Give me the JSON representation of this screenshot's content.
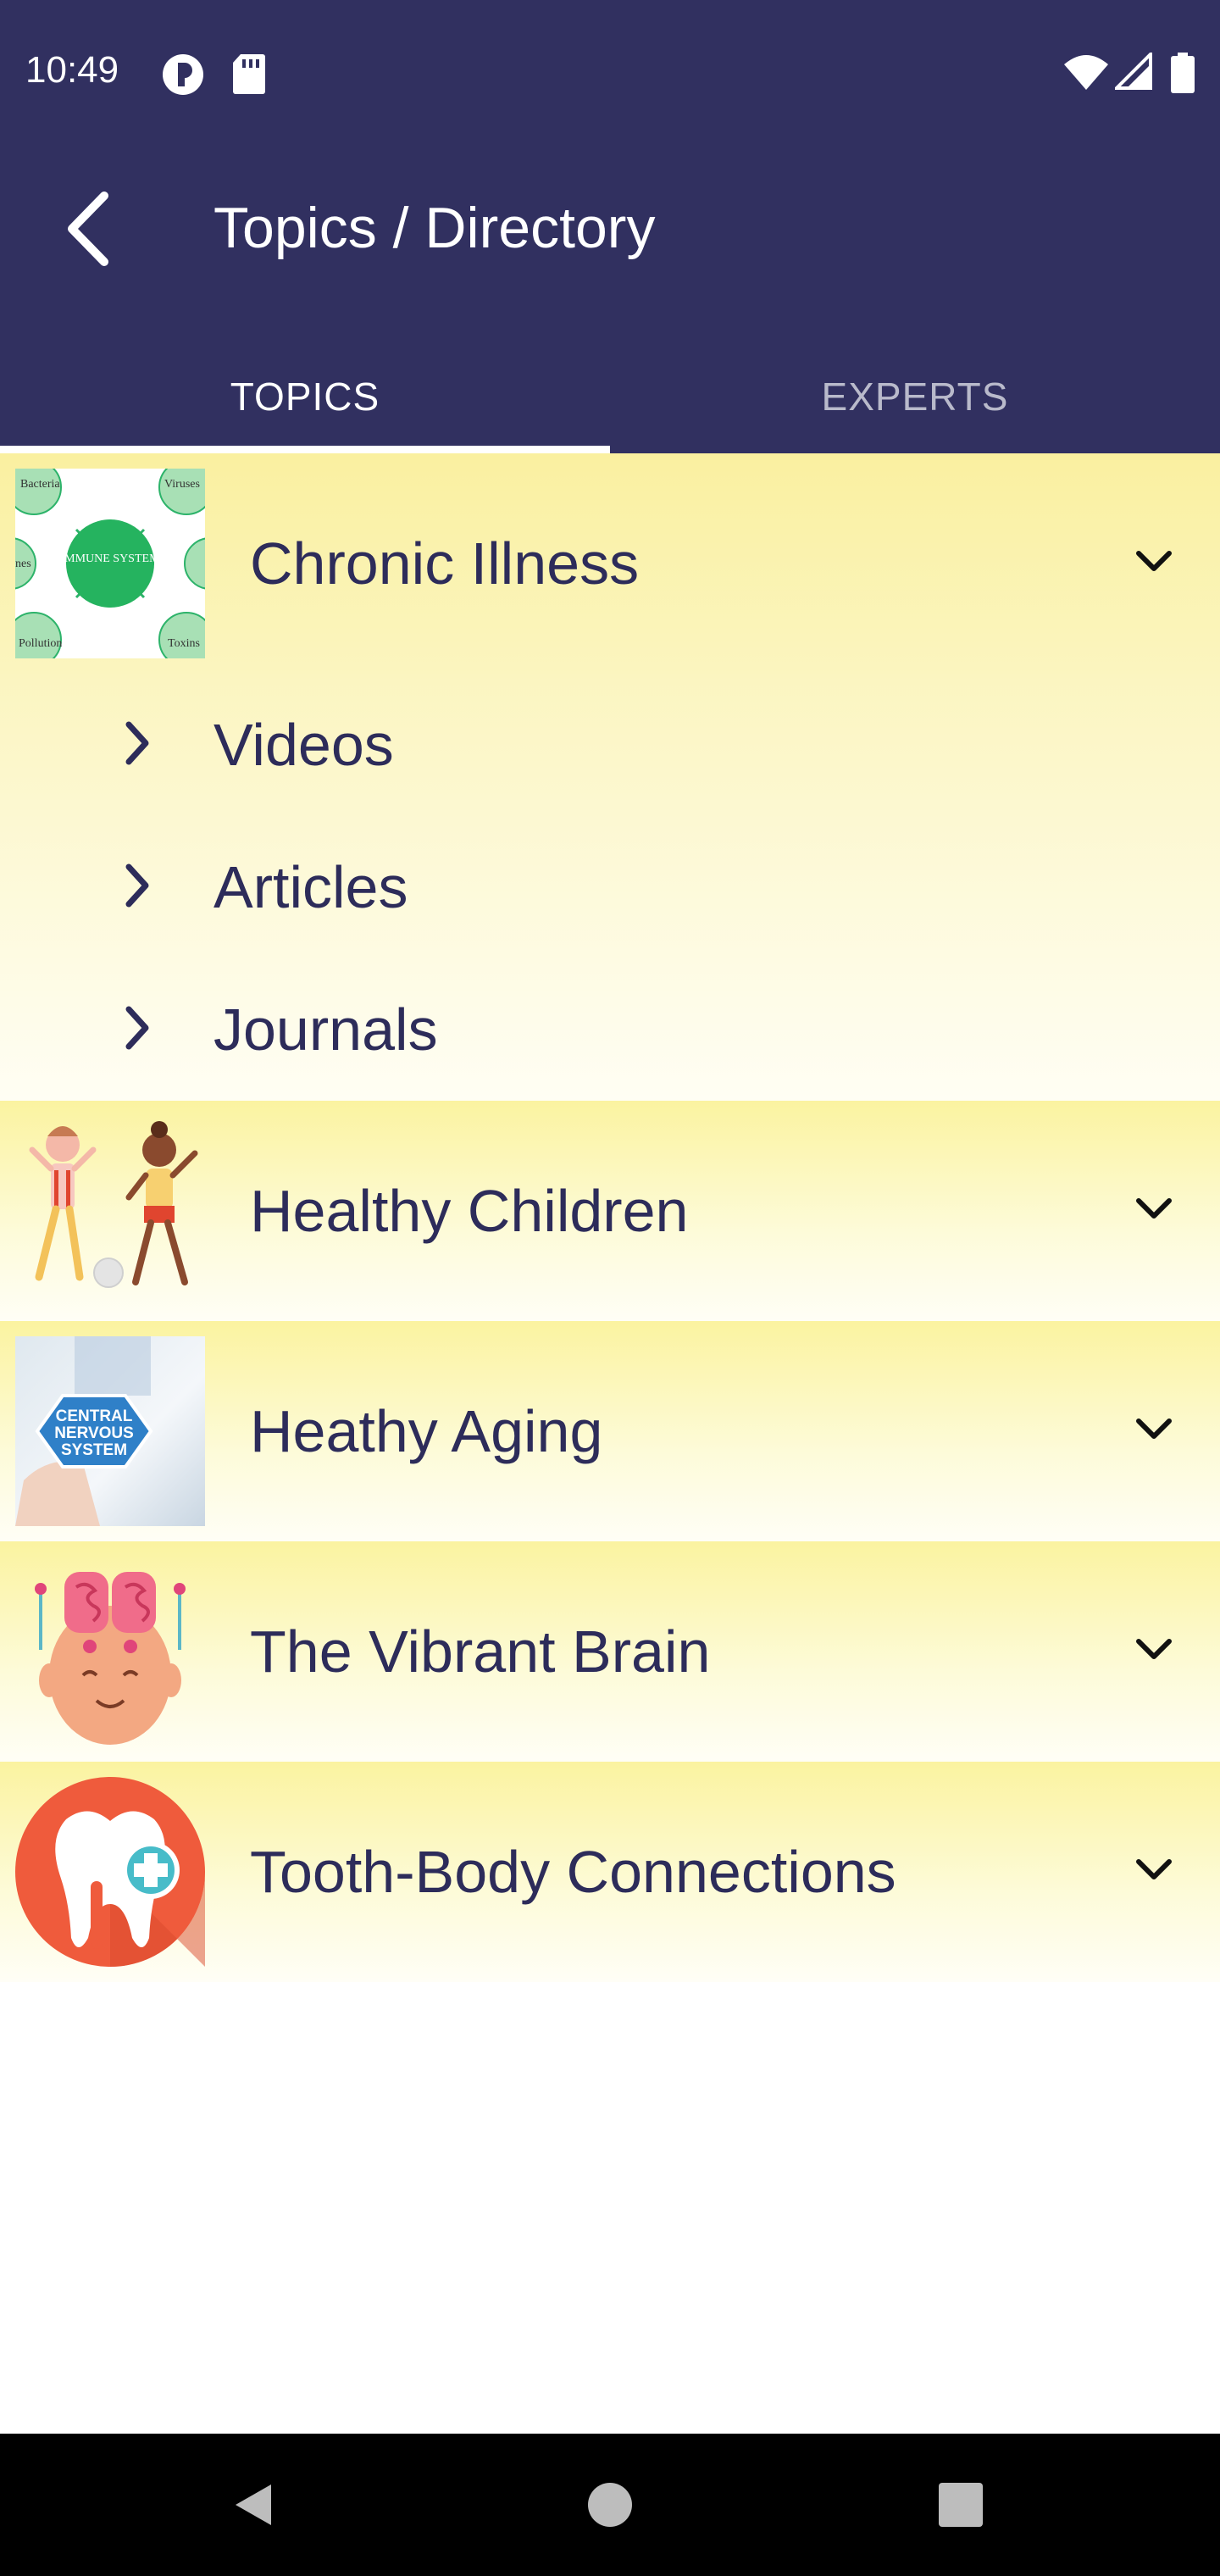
{
  "status_bar": {
    "time": "10:49",
    "icons": [
      "media-icon",
      "sd-card-icon",
      "wifi-icon",
      "cell-signal-icon",
      "battery-icon"
    ]
  },
  "app_bar": {
    "title": "Topics / Directory",
    "back_icon": "back-arrow-icon"
  },
  "tabs": [
    {
      "label": "TOPICS",
      "selected": true
    },
    {
      "label": "EXPERTS",
      "selected": false
    }
  ],
  "topics": [
    {
      "label": "Chronic Illness",
      "expanded": true,
      "thumbnail_text": {
        "center": "IMMUNE SYSTEM",
        "tl": "Bacteria",
        "tr": "Viruses",
        "bl": "Pollution",
        "br": "Toxins",
        "ml": "nes"
      },
      "children": [
        {
          "label": "Videos"
        },
        {
          "label": "Articles"
        },
        {
          "label": "Journals"
        }
      ]
    },
    {
      "label": "Healthy Children",
      "expanded": false
    },
    {
      "label": "Heathy Aging",
      "expanded": false,
      "thumbnail_text": {
        "center": "CENTRAL NERVOUS SYSTEM"
      }
    },
    {
      "label": "The Vibrant Brain",
      "expanded": false
    },
    {
      "label": "Tooth-Body Connections",
      "expanded": false
    }
  ],
  "colors": {
    "primary": "#313060",
    "row_yellow": "#fbf3a0",
    "text": "#2d2c5a",
    "tab_inactive": "#b9bacb"
  }
}
